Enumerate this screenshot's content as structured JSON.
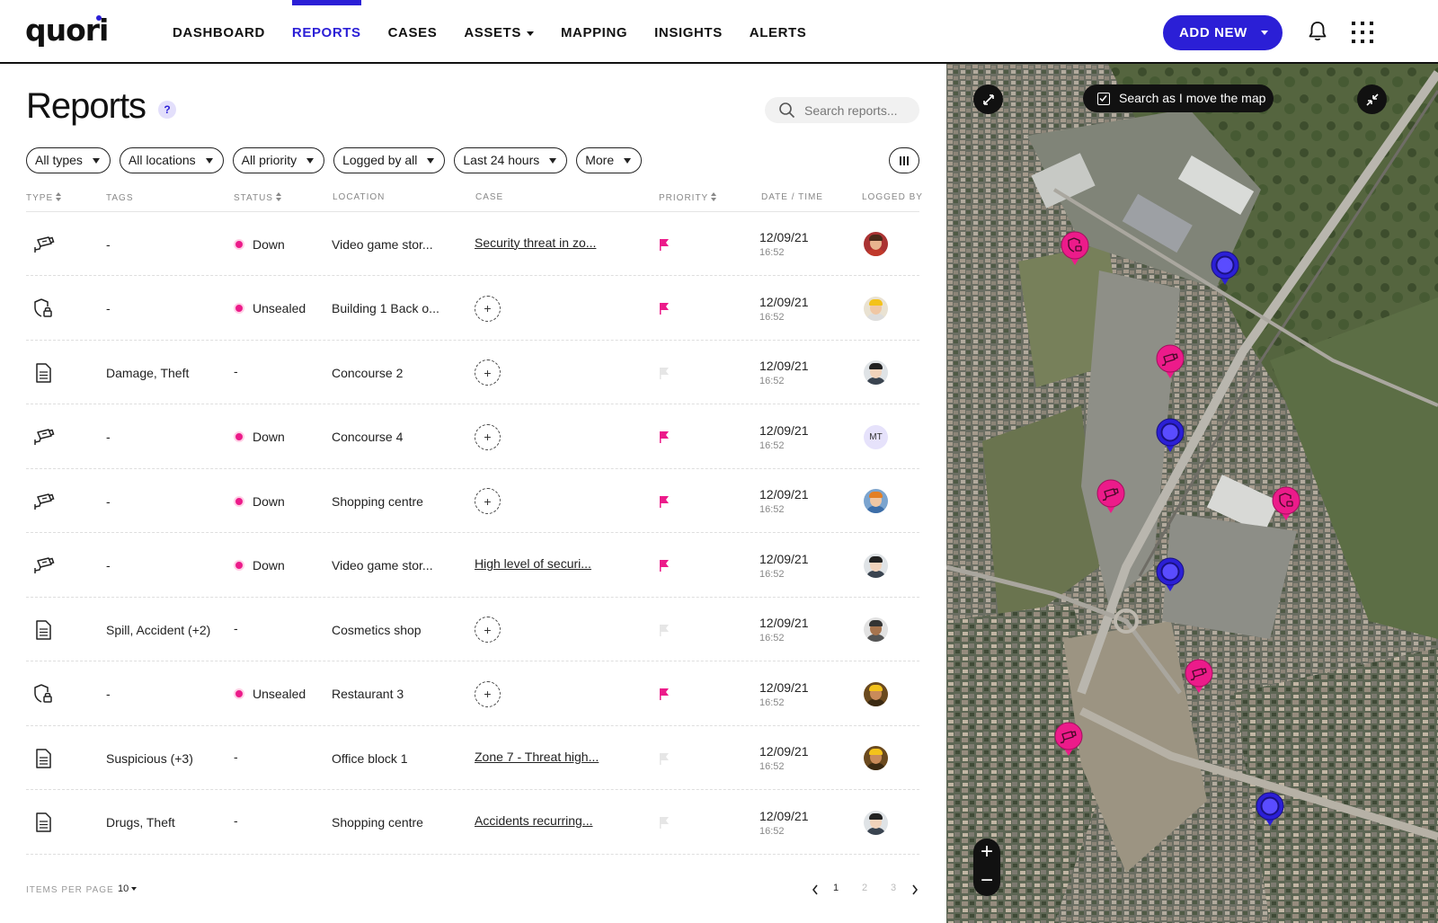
{
  "brand": {
    "name": "quori",
    "accent": "#2b1fd6",
    "alert": "#ec1b8a"
  },
  "nav": {
    "items": [
      {
        "label": "DASHBOARD"
      },
      {
        "label": "REPORTS",
        "active": true
      },
      {
        "label": "CASES"
      },
      {
        "label": "ASSETS",
        "dropdown": true
      },
      {
        "label": "MAPPING"
      },
      {
        "label": "INSIGHTS"
      },
      {
        "label": "ALERTS"
      }
    ],
    "add_new": "ADD NEW",
    "icons": [
      "bell-icon",
      "apps-grid-icon"
    ]
  },
  "page": {
    "title": "Reports",
    "help": "?",
    "search_placeholder": "Search reports..."
  },
  "filters": [
    "All types",
    "All locations",
    "All priority",
    "Logged by all",
    "Last 24 hours",
    "More"
  ],
  "table": {
    "headers": {
      "type": "TYPE",
      "tags": "TAGS",
      "status": "STATUS",
      "location": "LOCATION",
      "case": "CASE",
      "priority": "PRIORITY",
      "datetime": "DATE / TIME",
      "logged_by": "LOGGED BY"
    },
    "rows": [
      {
        "type": "camera",
        "tags": "-",
        "status": "Down",
        "location": "Video game stor...",
        "case": "Security threat in zo...",
        "priority": true,
        "date": "12/09/21",
        "time": "16:52",
        "avatar": "a1"
      },
      {
        "type": "shield-lock",
        "tags": "-",
        "status": "Unsealed",
        "location": "Building 1 Back o...",
        "case": "",
        "priority": true,
        "date": "12/09/21",
        "time": "16:52",
        "avatar": "a2"
      },
      {
        "type": "document",
        "tags": "Damage, Theft",
        "status": "-",
        "location": "Concourse 2",
        "case": "",
        "priority": false,
        "date": "12/09/21",
        "time": "16:52",
        "avatar": "a3"
      },
      {
        "type": "camera",
        "tags": "-",
        "status": "Down",
        "location": "Concourse 4",
        "case": "",
        "priority": true,
        "date": "12/09/21",
        "time": "16:52",
        "avatar": "MT"
      },
      {
        "type": "camera",
        "tags": "-",
        "status": "Down",
        "location": "Shopping centre",
        "case": "",
        "priority": true,
        "date": "12/09/21",
        "time": "16:52",
        "avatar": "a4"
      },
      {
        "type": "camera",
        "tags": "-",
        "status": "Down",
        "location": "Video game stor...",
        "case": "High level of securi...",
        "priority": true,
        "date": "12/09/21",
        "time": "16:52",
        "avatar": "a3"
      },
      {
        "type": "document",
        "tags": "Spill, Accident (+2)",
        "status": "-",
        "location": "Cosmetics shop",
        "case": "",
        "priority": false,
        "date": "12/09/21",
        "time": "16:52",
        "avatar": "a5"
      },
      {
        "type": "shield-lock",
        "tags": "-",
        "status": "Unsealed",
        "location": "Restaurant 3",
        "case": "",
        "priority": true,
        "date": "12/09/21",
        "time": "16:52",
        "avatar": "a6"
      },
      {
        "type": "document",
        "tags": "Suspicious (+3)",
        "status": "-",
        "location": "Office block 1",
        "case": "Zone 7 - Threat high...",
        "priority": false,
        "date": "12/09/21",
        "time": "16:52",
        "avatar": "a6"
      },
      {
        "type": "document",
        "tags": "Drugs, Theft",
        "status": "-",
        "location": "Shopping centre",
        "case": "Accidents recurring...",
        "priority": false,
        "date": "12/09/21",
        "time": "16:52",
        "avatar": "a3"
      }
    ]
  },
  "footer": {
    "items_per_page_label": "ITEMS PER PAGE",
    "items_per_page": "10",
    "pages": [
      "1",
      "2",
      "3"
    ],
    "current_page": "1"
  },
  "map": {
    "toggle_label": "Search as I move the map",
    "zoom_in": "+",
    "zoom_out": "−",
    "pins": [
      {
        "kind": "shield-lock"
      },
      {
        "kind": "asset"
      },
      {
        "kind": "camera"
      },
      {
        "kind": "asset"
      },
      {
        "kind": "camera"
      },
      {
        "kind": "shield-lock"
      },
      {
        "kind": "asset"
      },
      {
        "kind": "camera"
      },
      {
        "kind": "camera"
      },
      {
        "kind": "asset"
      }
    ]
  }
}
